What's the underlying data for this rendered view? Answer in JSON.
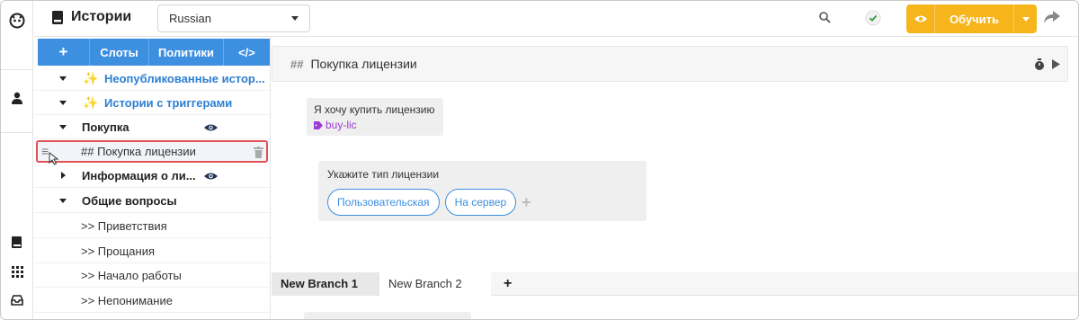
{
  "header": {
    "title": "Истории",
    "language": "Russian",
    "train_label": "Обучить"
  },
  "toolbar": {
    "add": "+",
    "slots": "Слоты",
    "policies": "Политики",
    "code": "</>"
  },
  "tree": {
    "items": [
      {
        "label": "Неопубликованные истор...",
        "icon": "sparkle-icon"
      },
      {
        "label": "Истории с триггерами",
        "icon": "sparkle-icon"
      },
      {
        "label": "Покупка"
      },
      {
        "label": "## Покупка лицензии"
      },
      {
        "label": "Информация о ли..."
      },
      {
        "label": "Общие вопросы"
      },
      {
        "label": ">> Приветствия"
      },
      {
        "label": ">> Прощания"
      },
      {
        "label": ">> Начало работы"
      },
      {
        "label": ">> Непонимание"
      }
    ]
  },
  "editor": {
    "hash": "##",
    "title": "Покупка лицензии",
    "phrase": "Я хочу купить лицензию",
    "intent_tag": "buy-lic",
    "reply": "Укажите тип лицензии",
    "buttons": [
      "Пользовательская",
      "На сервер"
    ],
    "branches": [
      "New Branch 1",
      "New Branch 2"
    ],
    "add_branch": "+"
  },
  "colors": {
    "accent_blue": "#3d8fe0",
    "train_yellow": "#f5b51b",
    "highlight_red": "#e05256",
    "tag_purple": "#9b3bd6"
  }
}
